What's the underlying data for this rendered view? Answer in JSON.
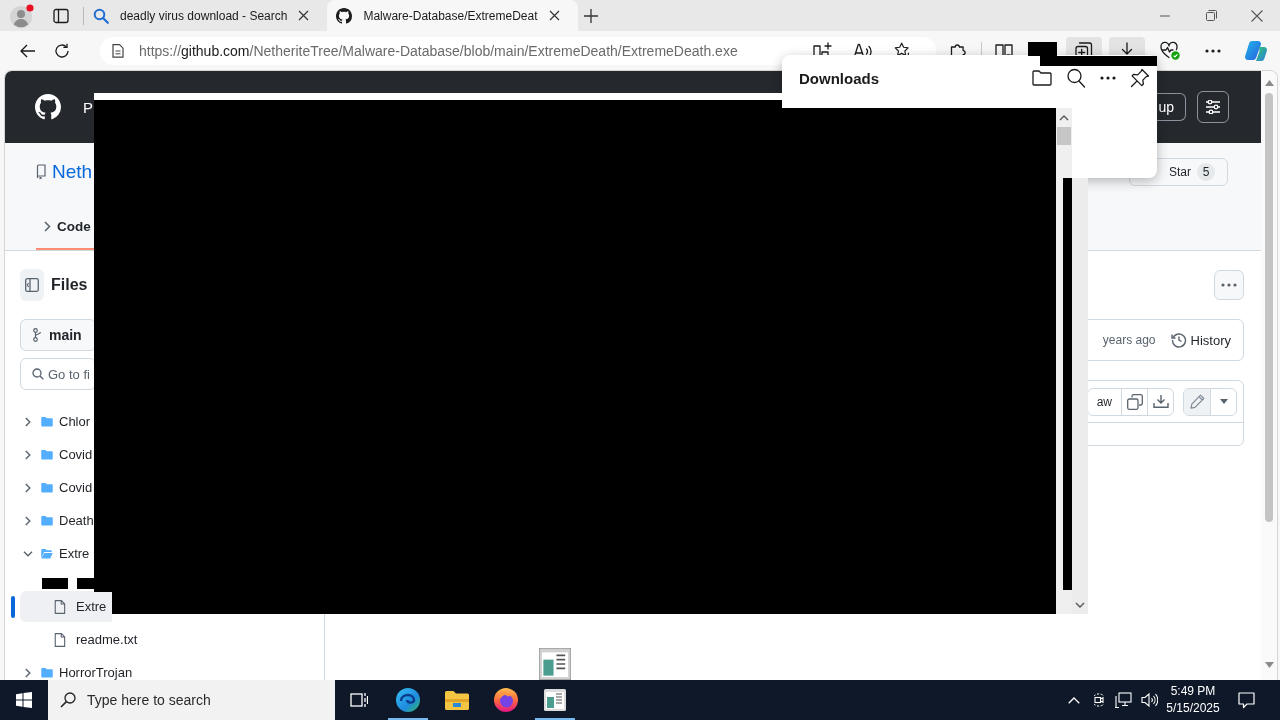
{
  "profile": {
    "notification": true
  },
  "tabs": [
    {
      "kind": "search",
      "title": "deadly virus download - Search",
      "selected": false
    },
    {
      "kind": "repository",
      "title": "Malware-Database/ExtremeDeat",
      "selected": true
    }
  ],
  "toolbar": {
    "address": {
      "scheme": "https://",
      "host": "github.com",
      "path": "/NetheriteTree/Malware-Database/blob/main/ExtremeDeath/ExtremeDeath.exe"
    },
    "buttons": [
      {
        "kind": "extensions",
        "active": false
      },
      {
        "kind": "split-screen",
        "active": false
      },
      {
        "kind": "collections",
        "active": true
      },
      {
        "kind": "downloads",
        "active": true
      },
      {
        "kind": "essentials",
        "active": false
      },
      {
        "kind": "more",
        "active": false
      },
      {
        "kind": "copilot",
        "active": false
      }
    ]
  },
  "downloads_panel": {
    "title": "Downloads"
  },
  "page": {
    "header": {
      "nav_item": "P",
      "signup": "up"
    },
    "repo": {
      "name": "Neth",
      "tabs": [
        {
          "label": "Code",
          "selected": true
        }
      ],
      "star": {
        "label": "Star",
        "count": "5"
      }
    },
    "sidebar": {
      "title": "Files",
      "branch": "main",
      "search": {
        "placeholder": "Go to fi"
      },
      "tree": [
        {
          "kind": "folder",
          "name": "Chlor",
          "expanded": false,
          "selected": false
        },
        {
          "kind": "folder",
          "name": "Covid",
          "expanded": false,
          "selected": false
        },
        {
          "kind": "folder",
          "name": "Covid",
          "expanded": false,
          "selected": false
        },
        {
          "kind": "folder",
          "name": "Death",
          "expanded": false,
          "selected": false
        },
        {
          "kind": "folder",
          "name": "Extre",
          "expanded": true,
          "selected": false,
          "children": [
            {
              "kind": "file",
              "name": "Extre",
              "selected": true
            },
            {
              "kind": "file",
              "name": "readme.txt",
              "selected": false
            }
          ]
        },
        {
          "kind": "folder",
          "name": "HorrorTrojan",
          "expanded": false,
          "selected": false
        }
      ]
    },
    "file": {
      "age": "years ago",
      "history": "History",
      "raw": "aw"
    }
  },
  "overlay": {
    "kind": "blank"
  },
  "taskbar": {
    "search": {
      "placeholder": "Type here to search"
    },
    "apps": [
      {
        "kind": "edge",
        "running": true
      },
      {
        "kind": "explorer",
        "running": false
      },
      {
        "kind": "firefox",
        "running": false
      },
      {
        "kind": "app",
        "running": true
      }
    ],
    "time": "5:49 PM",
    "date": "5/15/2025"
  }
}
